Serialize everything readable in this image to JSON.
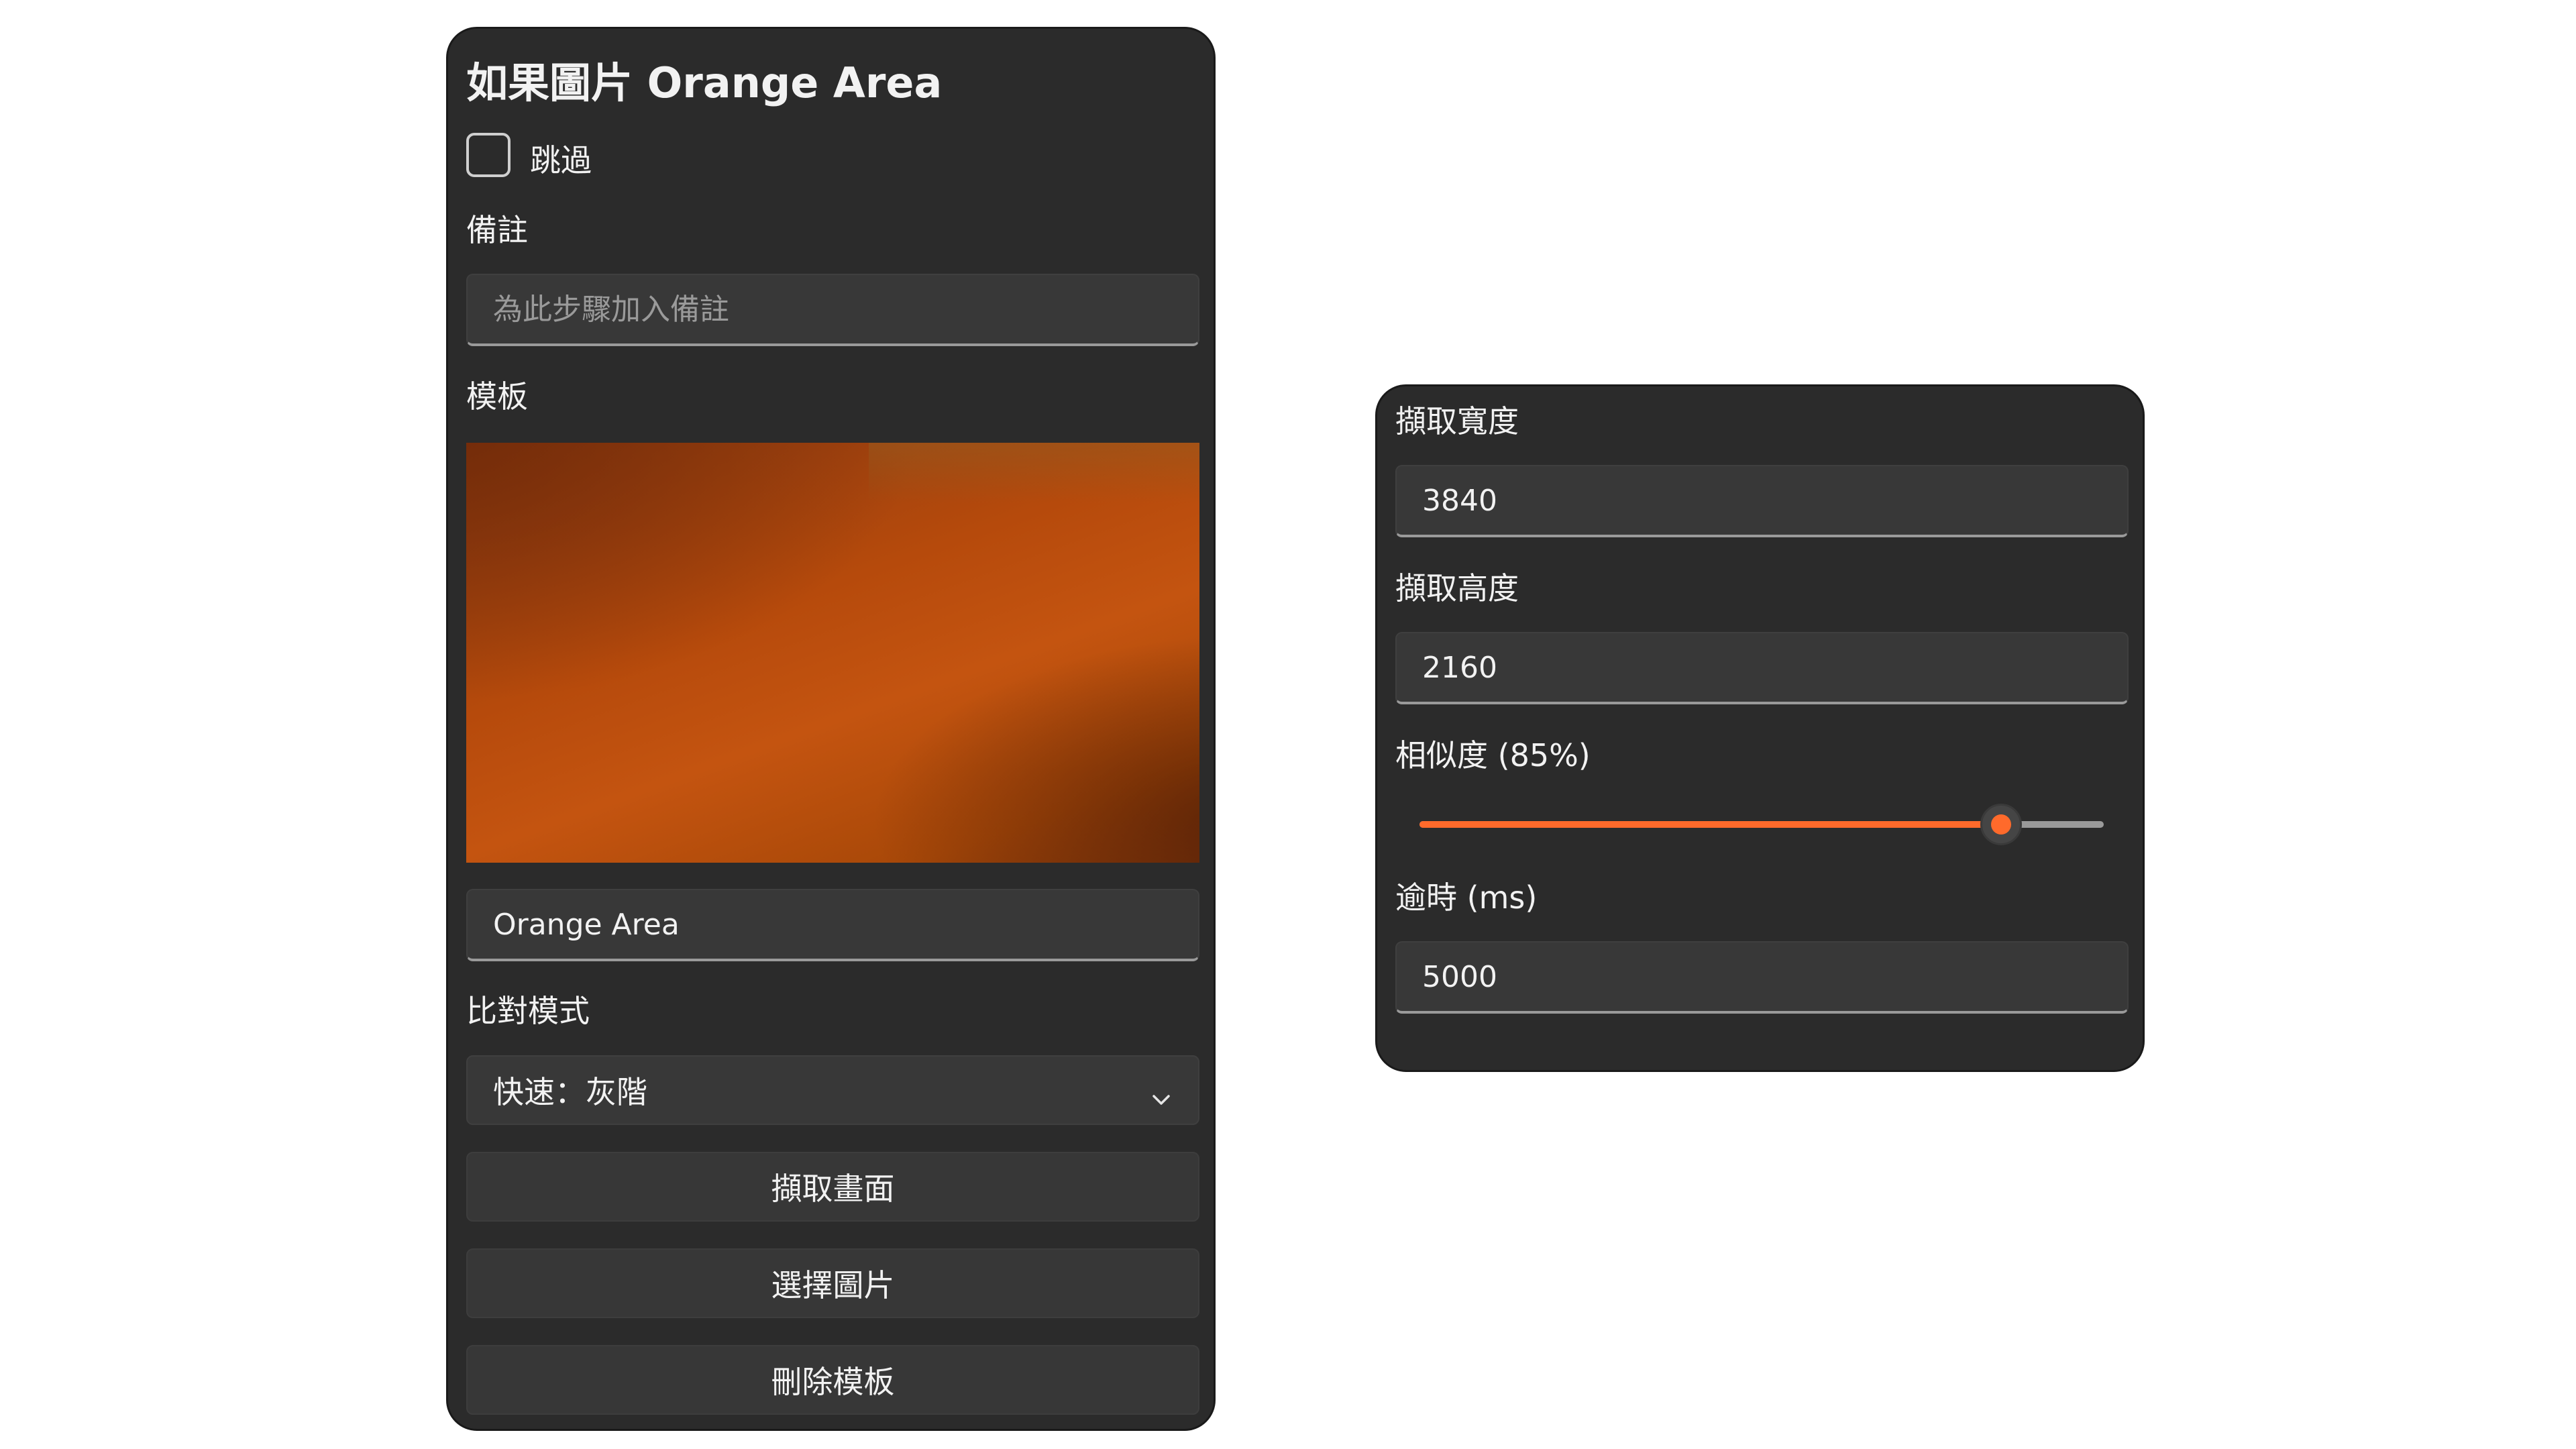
{
  "colors": {
    "panel_bg": "#2b2b2b",
    "accent": "#ff6a2b",
    "field_bg": "#383838",
    "text": "#f2f2f2"
  },
  "left": {
    "title": "如果圖片 Orange Area",
    "skip_label": "跳過",
    "skip_checked": false,
    "note_label": "備註",
    "note_placeholder": "為此步驟加入備註",
    "note_value": "",
    "template_label": "模板",
    "template_name_value": "Orange Area",
    "compare_mode_label": "比對模式",
    "compare_mode_selected": "快速：灰階",
    "chevron_icon": "chevron-down-icon",
    "capture_screen_button": "擷取畫面",
    "choose_image_button": "選擇圖片",
    "delete_template_button": "刪除模板"
  },
  "right": {
    "capture_width_label": "擷取寬度",
    "capture_width_value": "3840",
    "capture_height_label": "擷取高度",
    "capture_height_value": "2160",
    "similarity_label": "相似度 (85%)",
    "similarity_value": 0.85,
    "timeout_label": "逾時 (ms)",
    "timeout_value": "5000"
  }
}
